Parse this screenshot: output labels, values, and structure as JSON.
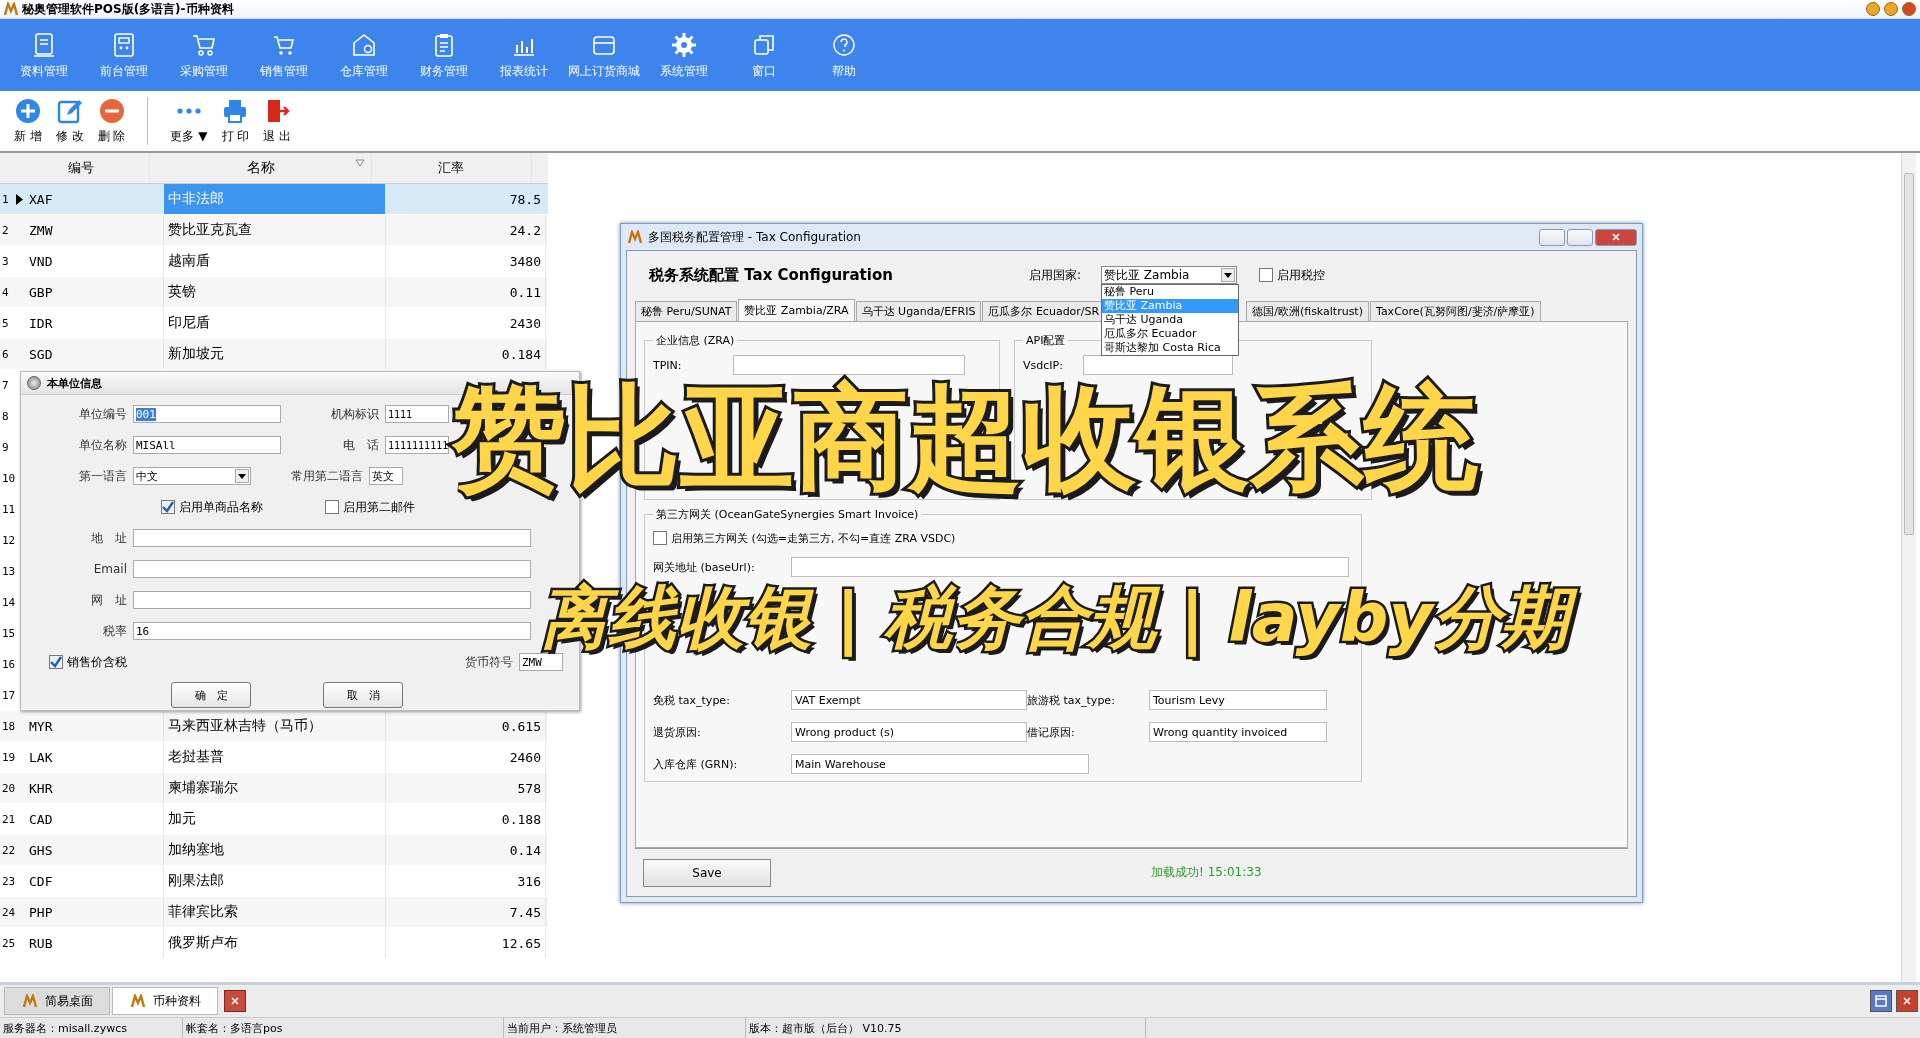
{
  "window": {
    "title": "秘奥管理软件POS版(多语言)-币种资料"
  },
  "nav": [
    {
      "label": "资料管理"
    },
    {
      "label": "前台管理"
    },
    {
      "label": "采购管理"
    },
    {
      "label": "销售管理"
    },
    {
      "label": "仓库管理"
    },
    {
      "label": "财务管理"
    },
    {
      "label": "报表统计"
    },
    {
      "label": "网上订货商城"
    },
    {
      "label": "系统管理"
    },
    {
      "label": "窗口"
    },
    {
      "label": "帮助"
    }
  ],
  "toolbar": [
    {
      "label": "新 增",
      "kind": "add"
    },
    {
      "label": "修 改",
      "kind": "edit"
    },
    {
      "label": "删 除",
      "kind": "delete"
    },
    {
      "label": "更多 ▼",
      "kind": "more"
    },
    {
      "label": "打 印",
      "kind": "print"
    },
    {
      "label": "退 出",
      "kind": "exit"
    }
  ],
  "grid": {
    "columns": [
      "编号",
      "名称",
      "汇率"
    ],
    "rows": [
      {
        "num": "1",
        "code": "XAF",
        "name": "中非法郎",
        "rate": "78.5",
        "selected": true
      },
      {
        "num": "2",
        "code": "ZMW",
        "name": "赞比亚克瓦查",
        "rate": "24.2",
        "selected": false
      },
      {
        "num": "3",
        "code": "VND",
        "name": "越南盾",
        "rate": "3480",
        "selected": false
      },
      {
        "num": "4",
        "code": "GBP",
        "name": "英镑",
        "rate": "0.11",
        "selected": false
      },
      {
        "num": "5",
        "code": "IDR",
        "name": "印尼盾",
        "rate": "2430",
        "selected": false
      },
      {
        "num": "6",
        "code": "SGD",
        "name": "新加坡元",
        "rate": "0.184",
        "selected": false
      },
      {
        "num": "7",
        "selected": false
      },
      {
        "num": "8",
        "selected": false
      },
      {
        "num": "9",
        "selected": false
      },
      {
        "num": "10",
        "selected": false
      },
      {
        "num": "11",
        "selected": false
      },
      {
        "num": "12",
        "selected": false
      },
      {
        "num": "13",
        "selected": false
      },
      {
        "num": "14",
        "selected": false
      },
      {
        "num": "15",
        "selected": false
      },
      {
        "num": "16",
        "selected": false
      },
      {
        "num": "17",
        "selected": false
      },
      {
        "num": "18",
        "code": "MYR",
        "name": "马来西亚林吉特（马币）",
        "rate": "0.615",
        "selected": false
      },
      {
        "num": "19",
        "code": "LAK",
        "name": "老挝基普",
        "rate": "2460",
        "selected": false
      },
      {
        "num": "20",
        "code": "KHR",
        "name": "柬埔寨瑞尔",
        "rate": "578",
        "selected": false
      },
      {
        "num": "21",
        "code": "CAD",
        "name": "加元",
        "rate": "0.188",
        "selected": false
      },
      {
        "num": "22",
        "code": "GHS",
        "name": "加纳塞地",
        "rate": "0.14",
        "selected": false
      },
      {
        "num": "23",
        "code": "CDF",
        "name": "刚果法郎",
        "rate": "316",
        "selected": false
      },
      {
        "num": "24",
        "code": "PHP",
        "name": "菲律宾比索",
        "rate": "7.45",
        "selected": false
      },
      {
        "num": "25",
        "code": "RUB",
        "name": "俄罗斯卢布",
        "rate": "12.65",
        "selected": false
      }
    ]
  },
  "unit_panel": {
    "title": "本单位信息",
    "unit_code": {
      "label": "单位编号",
      "value": "001"
    },
    "org_id": {
      "label": "机构标识",
      "value": "1111"
    },
    "unit_name": {
      "label": "单位名称",
      "value": "MISAll"
    },
    "phone": {
      "label": "电　话",
      "value": "1111111111"
    },
    "first_language": {
      "label": "第一语言",
      "value": "中文"
    },
    "second_language": {
      "label": "常用第二语言",
      "value": "英文"
    },
    "single_name": {
      "label": "启用单商品名称",
      "checked": true
    },
    "second_mail": {
      "label": "启用第二邮件",
      "checked": false
    },
    "address": {
      "label": "地　址"
    },
    "email": {
      "label": "Email"
    },
    "website": {
      "label": "网　址"
    },
    "tax_rate": {
      "label": "税率",
      "value": "16"
    },
    "price_incl_tax": {
      "label": "销售价含税",
      "checked": true
    },
    "currency_symbol": {
      "label": "货币符号",
      "value": "ZMW"
    },
    "buttons": [
      "确　定",
      "取　消"
    ]
  },
  "tax_dialog": {
    "title": "多国税务配置管理 - Tax Configuration",
    "heading": "税务系统配置 Tax Configuration",
    "country_label": "启用国家:",
    "country_value": "赞比亚 Zambia",
    "country_options": [
      {
        "label": "秘鲁 Peru",
        "selected": false
      },
      {
        "label": "赞比亚 Zambia",
        "selected": true
      },
      {
        "label": "乌干达 Uganda",
        "selected": false
      },
      {
        "label": "厄瓜多尔 Ecuador",
        "selected": false
      },
      {
        "label": "哥斯达黎加 Costa Rica",
        "selected": false
      }
    ],
    "fiscal_control": {
      "label": "启用税控",
      "checked": false
    },
    "tabs": [
      {
        "label": "秘鲁 Peru/SUNAT",
        "selected": false
      },
      {
        "label": "赞比亚 Zambia/ZRA",
        "selected": true
      },
      {
        "label": "乌干达 Uganda/EFRIS",
        "selected": false
      },
      {
        "label": "厄瓜多尔 Ecuador/SR",
        "selected": false
      },
      {
        "label": "德国/欧洲(fiskaltrust)",
        "selected": false
      },
      {
        "label": "TaxCore(瓦努阿图/斐济/萨摩亚)",
        "selected": false
      }
    ],
    "company_group": {
      "title": "企业信息 (ZRA)",
      "tpin_label": "TPIN:"
    },
    "api_group": {
      "title": "API配置",
      "vsdcip_label": "VsdcIP:"
    },
    "gateway_group": {
      "title": "第三方网关 (OceanGateSynergies Smart Invoice)",
      "enable": {
        "label": "启用第三方网关 (勾选=走第三方, 不勾=直连 ZRA VSDC)",
        "checked": false
      },
      "base_url_label": "网关地址 (baseUrl):",
      "pairs": [
        [
          {
            "label": "免税 tax_type:",
            "value": "VAT Exempt"
          },
          {
            "label": "旅游税 tax_type:",
            "value": "Tourism Levy"
          }
        ],
        [
          {
            "label": "退货原因:",
            "value": "Wrong product (s)"
          },
          {
            "label": "借记原因:",
            "value": "Wrong quantity invoiced"
          }
        ],
        [
          {
            "label": "入库仓库 (GRN):",
            "value": "Main Warehouse"
          }
        ]
      ]
    },
    "save": "Save",
    "status": "加载成功! 15:01:33"
  },
  "overlay": {
    "headline": "赞比亚商超收银系统",
    "subtitle": "离线收银 | 税务合规 | layby分期"
  },
  "doc_tabs": [
    {
      "label": "简易桌面",
      "selected": false
    },
    {
      "label": "币种资料",
      "selected": true
    }
  ],
  "status_bar": [
    "服务器名：misall.zywcs",
    "帐套名：多语言pos",
    "当前用户：系统管理员",
    "版本：超市版（后台） V10.75"
  ]
}
